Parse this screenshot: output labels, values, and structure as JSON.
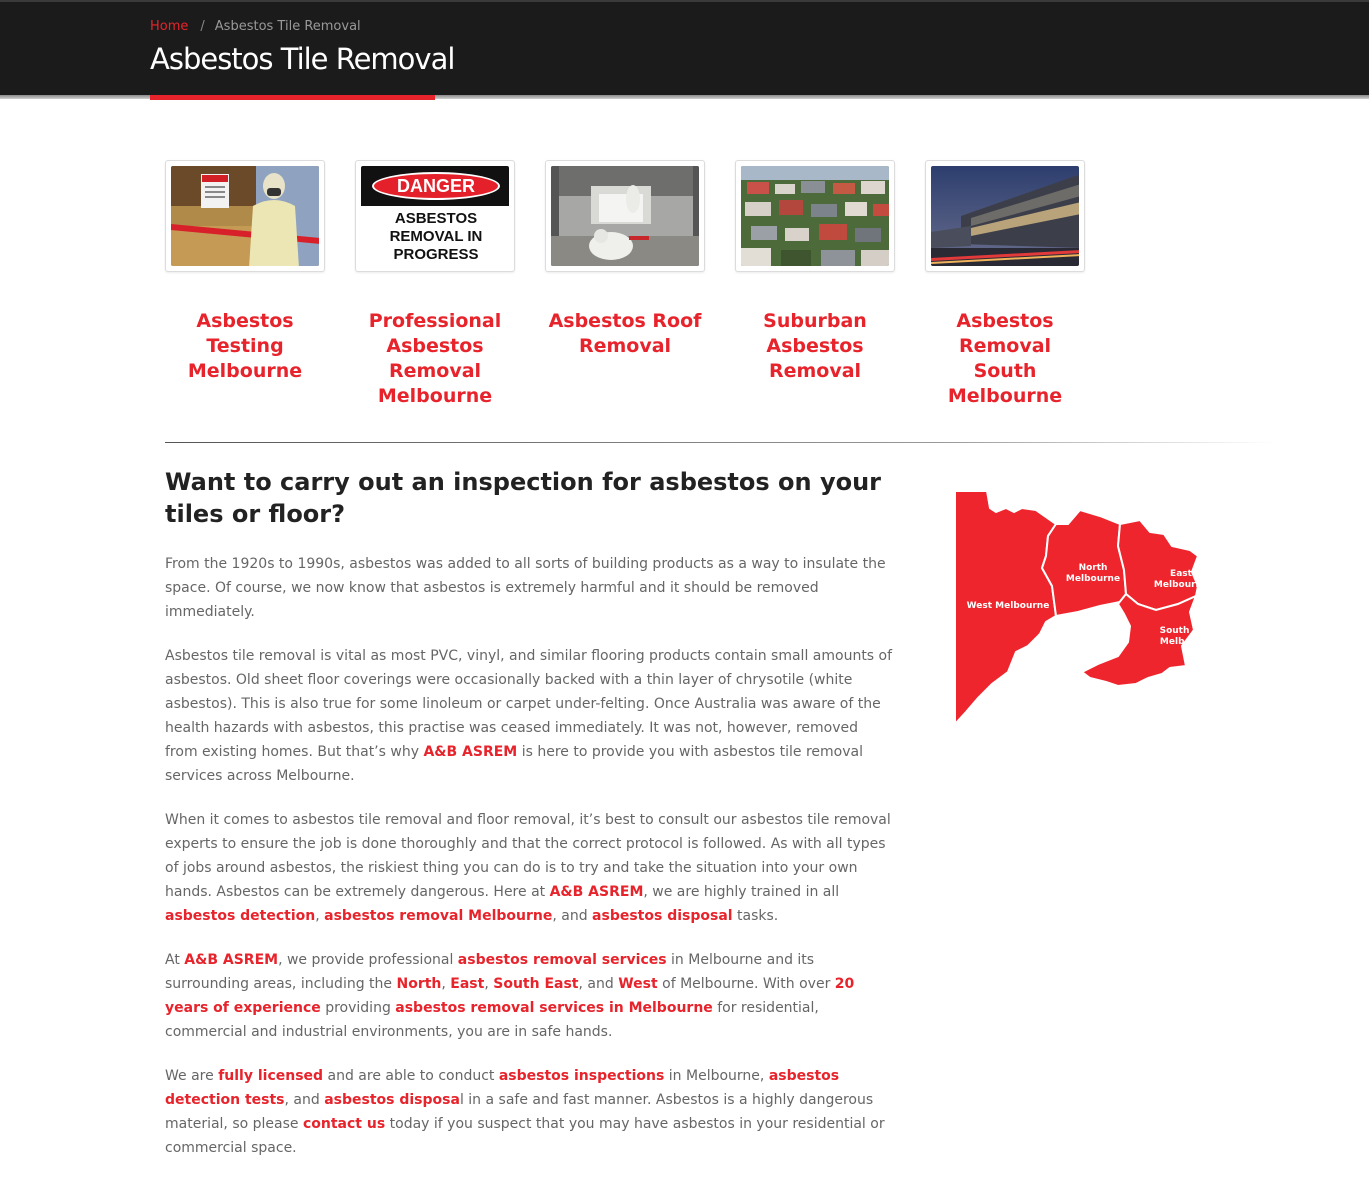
{
  "breadcrumb": {
    "home": "Home",
    "separator": "/",
    "current": "Asbestos Tile Removal"
  },
  "page_title": "Asbestos Tile Removal",
  "services": [
    {
      "title": "Asbestos Testing Melbourne",
      "image": "worker-in-protective-suit-photo"
    },
    {
      "title": "Professional Asbestos Removal Melbourne",
      "image": "danger-sign",
      "sign_header": "DANGER",
      "sign_body": "ASBESTOS REMOVAL IN PROGRESS"
    },
    {
      "title": "Asbestos Roof Removal",
      "image": "workers-in-ceiling-photo"
    },
    {
      "title": "Suburban Asbestos Removal",
      "image": "suburb-rooftops-photo"
    },
    {
      "title": "Asbestos Removal South Melbourne",
      "image": "modern-building-photo"
    }
  ],
  "article": {
    "heading": "Want to carry out an inspection for asbestos on your tiles or floor?",
    "p1": "From the 1920s to 1990s, asbestos was added to all sorts of building products as a way to insulate the space. Of course, we now know that asbestos is extremely harmful and it should be removed immediately.",
    "p2": {
      "text1": "Asbestos tile removal is vital as most PVC, vinyl, and similar flooring products contain small amounts of asbestos. Old sheet floor coverings were occasionally backed with a thin layer of chrysotile (white asbestos). This is also true for some linoleum or carpet under-felting. Once Australia was aware of the health hazards with asbestos, this practise was ceased immediately. It was not, however, removed from existing homes. But that’s why ",
      "link1": "A&B ASREM",
      "text2": " is here to provide you with asbestos tile removal services across Melbourne."
    },
    "p3": {
      "text1": "When it comes to asbestos tile removal and floor removal, it’s best to consult our asbestos tile removal experts to ensure the job is done thoroughly and that the correct protocol is followed. As with all types of jobs around asbestos, the riskiest thing you can do is to try and take the situation into your own hands. Asbestos can be extremely dangerous. Here at ",
      "link1": "A&B ASREM",
      "text2": ", we are highly trained in all ",
      "link2": "asbestos detection",
      "text3": ", ",
      "link3": "asbestos removal Melbourne",
      "text4": ", and ",
      "link4": "asbestos disposal",
      "text5": " tasks."
    },
    "p4": {
      "text1": "At ",
      "link1": "A&B ASREM",
      "text2": ", we provide professional ",
      "link2": "asbestos removal services",
      "text3": " in Melbourne and its surrounding areas, including the ",
      "link3": "North",
      "text4": ", ",
      "link4": "East",
      "text5": ", ",
      "link5": "South East",
      "text6": ", and ",
      "link6": "West",
      "text7": " of Melbourne. With over ",
      "link7": "20 years of experience",
      "text8": " providing ",
      "link8": "asbestos removal services in Melbourne",
      "text9": " for residential, commercial and industrial environments, you are in safe hands."
    },
    "p5": {
      "text1": "We are ",
      "link1": "fully licensed",
      "text2": " and are able to conduct ",
      "link2": "asbestos inspections",
      "text3": " in Melbourne, ",
      "link3": "asbestos detection tests",
      "text4": ", and ",
      "link4": "asbestos disposa",
      "text5": "l in a safe and fast manner. Asbestos is a highly dangerous material, so please ",
      "link5": "contact us",
      "text6": " today if you suspect that you may have asbestos in your residential or commercial space."
    }
  },
  "map": {
    "regions": [
      {
        "label_lines": [
          "West Melbourne"
        ]
      },
      {
        "label_lines": [
          "North",
          "Melbourne"
        ]
      },
      {
        "label_lines": [
          "East",
          "Melbourne"
        ]
      },
      {
        "label_lines": [
          "South East",
          "Melbourne"
        ]
      }
    ]
  },
  "colors": {
    "accent": "#e7232b",
    "header_bg": "#1b1b1b",
    "heading": "#222222",
    "body_text": "#666666"
  }
}
